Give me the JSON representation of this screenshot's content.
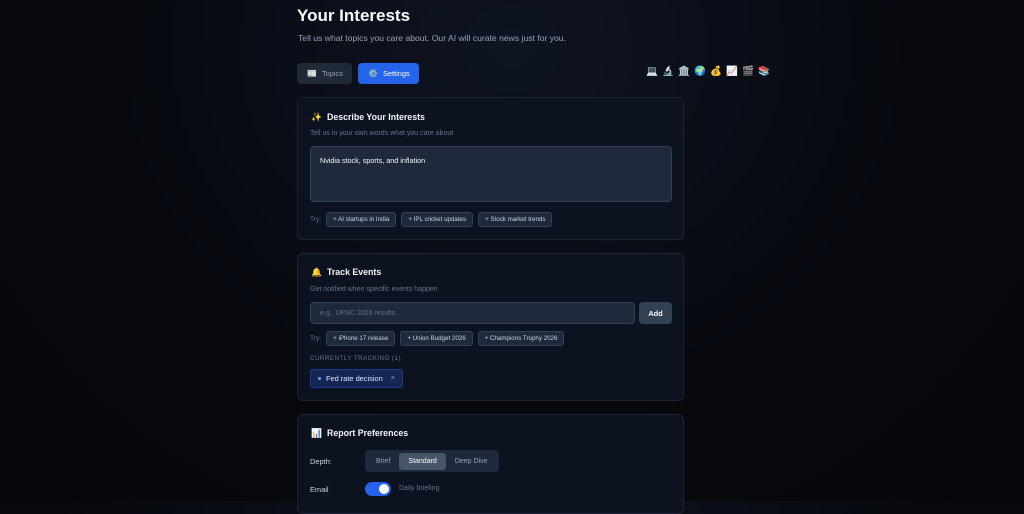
{
  "header": {
    "title": "Your Interests",
    "subtitle": "Tell us what topics you care about. Our AI will curate news just for you."
  },
  "tabs": [
    {
      "label": "Topics",
      "icon": "📰",
      "active": false
    },
    {
      "label": "Settings",
      "icon": "⚙️",
      "active": true
    }
  ],
  "category_icons": [
    "💻",
    "🔬",
    "🏛️",
    "🌍",
    "💰",
    "📈",
    "🎬",
    "📚"
  ],
  "interests": {
    "icon": "✨",
    "title": "Describe Your Interests",
    "subtitle": "Tell us in your own words what you care about",
    "value": "Nvidia stock, sports, and inflation",
    "try_label": "Try:",
    "suggestions": [
      "+ AI startups in India",
      "+ IPL cricket updates",
      "+ Stock market trends"
    ]
  },
  "events": {
    "icon": "🔔",
    "title": "Track Events",
    "subtitle": "Get notified when specific events happen",
    "placeholder": "e.g., UPSC 2026 results",
    "add_label": "Add",
    "try_label": "Try:",
    "suggestions": [
      "+ iPhone 17 release",
      "+ Union Budget 2026",
      "+ Champions Trophy 2026"
    ],
    "tracking_label": "CURRENTLY TRACKING (1)",
    "tracked": [
      "Fed rate decision"
    ],
    "remove_glyph": "×"
  },
  "preferences": {
    "icon": "📊",
    "title": "Report Preferences",
    "depth_label": "Depth:",
    "depth_options": [
      "Brief",
      "Standard",
      "Deep Dive"
    ],
    "depth_selected": "Standard",
    "email_label": "Email",
    "email_enabled": true,
    "email_text": "Daily briefing"
  },
  "colors": {
    "accent": "#2563eb",
    "background": "#07090f",
    "card": "#0d1220"
  }
}
